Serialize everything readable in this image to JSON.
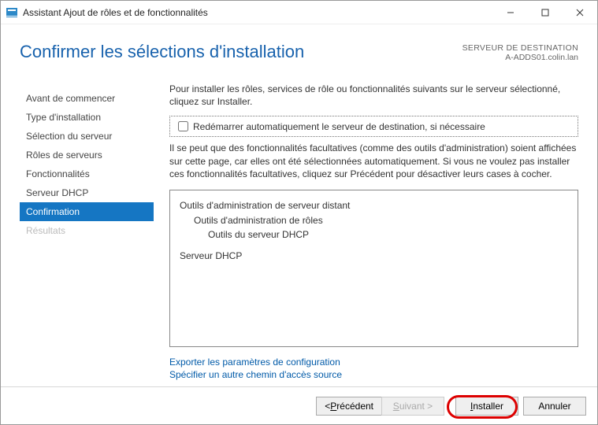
{
  "window": {
    "title": "Assistant Ajout de rôles et de fonctionnalités"
  },
  "header": {
    "page_title": "Confirmer les sélections d'installation",
    "dest_label": "SERVEUR DE DESTINATION",
    "dest_name": "A-ADDS01.colin.lan"
  },
  "sidebar": {
    "items": [
      {
        "label": "Avant de commencer"
      },
      {
        "label": "Type d'installation"
      },
      {
        "label": "Sélection du serveur"
      },
      {
        "label": "Rôles de serveurs"
      },
      {
        "label": "Fonctionnalités"
      },
      {
        "label": "Serveur DHCP"
      },
      {
        "label": "Confirmation"
      },
      {
        "label": "Résultats"
      }
    ]
  },
  "main": {
    "intro": "Pour installer les rôles, services de rôle ou fonctionnalités suivants sur le serveur sélectionné, cliquez sur Installer.",
    "restart_label": "Redémarrer automatiquement le serveur de destination, si nécessaire",
    "note": "Il se peut que des fonctionnalités facultatives (comme des outils d'administration) soient affichées sur cette page, car elles ont été sélectionnées automatiquement. Si vous ne voulez pas installer ces fonctionnalités facultatives, cliquez sur Précédent pour désactiver leurs cases à cocher.",
    "listing": {
      "l0": "Outils d'administration de serveur distant",
      "l1": "Outils d'administration de rôles",
      "l2": "Outils du serveur DHCP",
      "l3": "Serveur DHCP"
    },
    "links": {
      "export": "Exporter les paramètres de configuration",
      "altpath": "Spécifier un autre chemin d'accès source"
    }
  },
  "footer": {
    "prev_prefix": "< ",
    "prev_u": "P",
    "prev_rest": "récédent",
    "next_u": "S",
    "next_rest": "uivant >",
    "install_u": "I",
    "install_rest": "nstaller",
    "cancel": "Annuler"
  }
}
